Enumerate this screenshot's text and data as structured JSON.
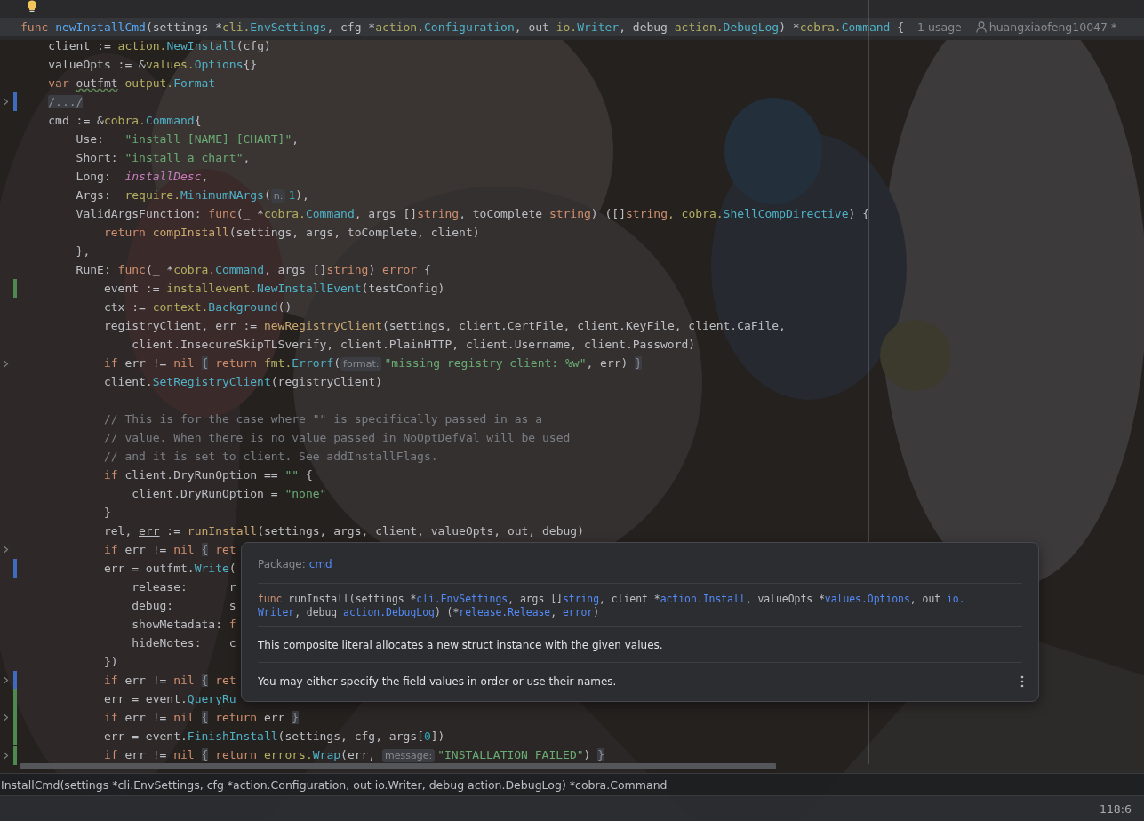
{
  "editor": {
    "signature_line": {
      "usages": "1 usage",
      "author": "huangxiaofeng10047 *",
      "tokens": [
        {
          "kind": "kw",
          "text": "func "
        },
        {
          "kind": "fn",
          "text": "newInstallCmd"
        },
        {
          "kind": "p",
          "text": "(settings *"
        },
        {
          "kind": "pkg",
          "text": "cli."
        },
        {
          "kind": "mem",
          "text": "EnvSettings"
        },
        {
          "kind": "p",
          "text": ", cfg *"
        },
        {
          "kind": "pkg",
          "text": "action."
        },
        {
          "kind": "mem",
          "text": "Configuration"
        },
        {
          "kind": "p",
          "text": ", out "
        },
        {
          "kind": "pkg",
          "text": "io."
        },
        {
          "kind": "mem",
          "text": "Writer"
        },
        {
          "kind": "p",
          "text": ", debug "
        },
        {
          "kind": "pkg",
          "text": "action."
        },
        {
          "kind": "mem",
          "text": "DebugLog"
        },
        {
          "kind": "p",
          "text": ") *"
        },
        {
          "kind": "pkg",
          "text": "cobra."
        },
        {
          "kind": "mem",
          "text": "Command"
        },
        {
          "kind": "p",
          "text": " {"
        }
      ]
    },
    "lines": [
      {
        "folded": false,
        "modified": false,
        "added": false,
        "tokens": [
          {
            "kind": "p",
            "text": "client := "
          },
          {
            "kind": "pkg",
            "text": "action."
          },
          {
            "kind": "mem",
            "text": "NewInstall"
          },
          {
            "kind": "p",
            "text": "(cfg)"
          }
        ]
      },
      {
        "folded": false,
        "modified": false,
        "added": false,
        "tokens": [
          {
            "kind": "p",
            "text": "valueOpts := &"
          },
          {
            "kind": "pkg",
            "text": "values."
          },
          {
            "kind": "mem",
            "text": "Options"
          },
          {
            "kind": "p",
            "text": "{}"
          }
        ]
      },
      {
        "folded": false,
        "modified": false,
        "added": false,
        "tokens": [
          {
            "kind": "kw",
            "text": "var "
          },
          {
            "kind": "warn",
            "text": "outfmt"
          },
          {
            "kind": "pkg",
            "text": " output."
          },
          {
            "kind": "mem",
            "text": "Format"
          }
        ]
      },
      {
        "folded": true,
        "modified": true,
        "added": false,
        "tokens": [
          {
            "kind": "fold",
            "text": "/.../"
          }
        ]
      },
      {
        "folded": false,
        "modified": false,
        "added": false,
        "tokens": [
          {
            "kind": "p",
            "text": "cmd := &"
          },
          {
            "kind": "pkg",
            "text": "cobra."
          },
          {
            "kind": "mem",
            "text": "Command"
          },
          {
            "kind": "p",
            "text": "{"
          }
        ],
        "children": [
          {
            "folded": false,
            "modified": false,
            "added": false,
            "tokens": [
              {
                "kind": "p",
                "text": "Use:   "
              },
              {
                "kind": "str",
                "text": "\"install [NAME] [CHART]\""
              },
              {
                "kind": "p",
                "text": ","
              }
            ]
          },
          {
            "folded": false,
            "modified": false,
            "added": false,
            "tokens": [
              {
                "kind": "p",
                "text": "Short: "
              },
              {
                "kind": "str",
                "text": "\"install a chart\""
              },
              {
                "kind": "p",
                "text": ","
              }
            ]
          },
          {
            "folded": false,
            "modified": false,
            "added": false,
            "tokens": [
              {
                "kind": "p",
                "text": "Long:  "
              },
              {
                "kind": "const",
                "text": "installDesc"
              },
              {
                "kind": "p",
                "text": ","
              }
            ]
          },
          {
            "folded": false,
            "modified": false,
            "added": false,
            "tokens": [
              {
                "kind": "p",
                "text": "Args:  "
              },
              {
                "kind": "pkg",
                "text": "require."
              },
              {
                "kind": "mem",
                "text": "MinimumNArgs"
              },
              {
                "kind": "p",
                "text": "("
              },
              {
                "kind": "hint",
                "text": "n:"
              },
              {
                "kind": "num",
                "text": "1"
              },
              {
                "kind": "p",
                "text": "),"
              }
            ]
          },
          {
            "folded": false,
            "modified": false,
            "added": false,
            "tokens": [
              {
                "kind": "p",
                "text": "ValidArgsFunction: "
              },
              {
                "kind": "kw",
                "text": "func"
              },
              {
                "kind": "p",
                "text": "(_ *"
              },
              {
                "kind": "pkg",
                "text": "cobra."
              },
              {
                "kind": "mem",
                "text": "Command"
              },
              {
                "kind": "p",
                "text": ", args []"
              },
              {
                "kind": "kw",
                "text": "string"
              },
              {
                "kind": "p",
                "text": ", toComplete "
              },
              {
                "kind": "kw",
                "text": "string"
              },
              {
                "kind": "p",
                "text": ") ([]"
              },
              {
                "kind": "kw",
                "text": "string"
              },
              {
                "kind": "pkg",
                "text": ", cobra."
              },
              {
                "kind": "mem",
                "text": "ShellCompDirective"
              },
              {
                "kind": "p",
                "text": ") {"
              }
            ],
            "children": [
              {
                "folded": false,
                "modified": false,
                "added": false,
                "tokens": [
                  {
                    "kind": "kw",
                    "text": "return "
                  },
                  {
                    "kind": "call",
                    "text": "compInstall"
                  },
                  {
                    "kind": "p",
                    "text": "(settings, args, toComplete, client)"
                  }
                ]
              }
            ]
          },
          {
            "folded": false,
            "modified": false,
            "added": false,
            "tokens": [
              {
                "kind": "p",
                "text": "},"
              }
            ]
          },
          {
            "folded": false,
            "modified": false,
            "added": false,
            "tokens": [
              {
                "kind": "p",
                "text": "RunE: "
              },
              {
                "kind": "kw",
                "text": "func"
              },
              {
                "kind": "p",
                "text": "(_ *"
              },
              {
                "kind": "pkg",
                "text": "cobra."
              },
              {
                "kind": "mem",
                "text": "Command"
              },
              {
                "kind": "p",
                "text": ", args []"
              },
              {
                "kind": "kw",
                "text": "string"
              },
              {
                "kind": "p",
                "text": ") "
              },
              {
                "kind": "kw",
                "text": "error"
              },
              {
                "kind": "p",
                "text": " {"
              }
            ],
            "children": [
              {
                "folded": false,
                "modified": false,
                "added": true,
                "tokens": [
                  {
                    "kind": "p",
                    "text": "event := "
                  },
                  {
                    "kind": "pkg",
                    "text": "installevent."
                  },
                  {
                    "kind": "mem",
                    "text": "NewInstallEvent"
                  },
                  {
                    "kind": "p",
                    "text": "(testConfig)"
                  }
                ]
              },
              {
                "folded": false,
                "modified": false,
                "added": false,
                "tokens": [
                  {
                    "kind": "p",
                    "text": "ctx := "
                  },
                  {
                    "kind": "pkg",
                    "text": "context."
                  },
                  {
                    "kind": "mem",
                    "text": "Background"
                  },
                  {
                    "kind": "p",
                    "text": "()"
                  }
                ]
              },
              {
                "folded": false,
                "modified": false,
                "added": false,
                "tokens": [
                  {
                    "kind": "p",
                    "text": "registryClient, err := "
                  },
                  {
                    "kind": "call",
                    "text": "newRegistryClient"
                  },
                  {
                    "kind": "p",
                    "text": "(settings, client.CertFile, client.KeyFile, client.CaFile,"
                  }
                ],
                "children": [
                  {
                    "folded": false,
                    "modified": false,
                    "added": false,
                    "tokens": [
                      {
                        "kind": "p",
                        "text": "client.InsecureSkipTLSverify, client.PlainHTTP, client.Username, client.Password)"
                      }
                    ]
                  }
                ]
              },
              {
                "folded": true,
                "modified": false,
                "added": false,
                "tokens": [
                  {
                    "kind": "kw",
                    "text": "if "
                  },
                  {
                    "kind": "p",
                    "text": "err != "
                  },
                  {
                    "kind": "kw",
                    "text": "nil "
                  },
                  {
                    "kind": "brace",
                    "text": "{"
                  },
                  {
                    "kind": "kw",
                    "text": " return "
                  },
                  {
                    "kind": "pkg",
                    "text": "fmt."
                  },
                  {
                    "kind": "mem",
                    "text": "Errorf"
                  },
                  {
                    "kind": "p",
                    "text": "("
                  },
                  {
                    "kind": "hint",
                    "text": "format:"
                  },
                  {
                    "kind": "str",
                    "text": "\"missing registry client: %w\""
                  },
                  {
                    "kind": "p",
                    "text": ", err) "
                  },
                  {
                    "kind": "brace",
                    "text": "}"
                  }
                ]
              },
              {
                "folded": false,
                "modified": false,
                "added": false,
                "tokens": [
                  {
                    "kind": "p",
                    "text": "client."
                  },
                  {
                    "kind": "mem",
                    "text": "SetRegistryClient"
                  },
                  {
                    "kind": "p",
                    "text": "(registryClient)"
                  }
                ]
              },
              {
                "folded": false,
                "modified": false,
                "added": false
              },
              {
                "folded": false,
                "modified": false,
                "added": false,
                "tokens": [
                  {
                    "kind": "cmt",
                    "text": "// This is for the case where \"\" is specifically passed in as a"
                  }
                ]
              },
              {
                "folded": false,
                "modified": false,
                "added": false,
                "tokens": [
                  {
                    "kind": "cmt",
                    "text": "// value. When there is no value passed in NoOptDefVal will be used"
                  }
                ]
              },
              {
                "folded": false,
                "modified": false,
                "added": false,
                "tokens": [
                  {
                    "kind": "cmt",
                    "text": "// and it is set to client. See addInstallFlags."
                  }
                ]
              },
              {
                "folded": false,
                "modified": false,
                "added": false,
                "tokens": [
                  {
                    "kind": "kw",
                    "text": "if "
                  },
                  {
                    "kind": "p",
                    "text": "client.DryRunOption == "
                  },
                  {
                    "kind": "str",
                    "text": "\"\""
                  },
                  {
                    "kind": "p",
                    "text": " {"
                  }
                ],
                "children": [
                  {
                    "folded": false,
                    "modified": false,
                    "added": false,
                    "tokens": [
                      {
                        "kind": "p",
                        "text": "client.DryRunOption = "
                      },
                      {
                        "kind": "str",
                        "text": "\"none\""
                      }
                    ]
                  }
                ]
              },
              {
                "folded": false,
                "modified": false,
                "added": false,
                "tokens": [
                  {
                    "kind": "p",
                    "text": "}"
                  }
                ]
              },
              {
                "folded": false,
                "modified": false,
                "added": false,
                "tokens": [
                  {
                    "kind": "p",
                    "text": "rel, "
                  },
                  {
                    "kind": "ref",
                    "text": "err"
                  },
                  {
                    "kind": "p",
                    "text": " := "
                  },
                  {
                    "kind": "call",
                    "text": "runInstall"
                  },
                  {
                    "kind": "p",
                    "text": "(settings, args, client, valueOpts, out, debug)"
                  }
                ]
              },
              {
                "folded": true,
                "modified": false,
                "added": false,
                "tokens": [
                  {
                    "kind": "kw",
                    "text": "if "
                  },
                  {
                    "kind": "p",
                    "text": "err != "
                  },
                  {
                    "kind": "kw",
                    "text": "nil "
                  },
                  {
                    "kind": "brace",
                    "text": "{"
                  },
                  {
                    "kind": "kw",
                    "text": " ret"
                  }
                ]
              },
              {
                "folded": false,
                "modified": true,
                "added": false,
                "tokens": [
                  {
                    "kind": "p",
                    "text": "err = outfmt."
                  },
                  {
                    "kind": "mem",
                    "text": "Write"
                  },
                  {
                    "kind": "p",
                    "text": "("
                  }
                ],
                "children": [
                  {
                    "folded": false,
                    "modified": false,
                    "added": false,
                    "tokens": [
                      {
                        "kind": "p",
                        "text": "release:      r"
                      }
                    ]
                  },
                  {
                    "folded": false,
                    "modified": false,
                    "added": false,
                    "tokens": [
                      {
                        "kind": "p",
                        "text": "debug:        s"
                      }
                    ]
                  },
                  {
                    "folded": false,
                    "modified": false,
                    "added": false,
                    "tokens": [
                      {
                        "kind": "p",
                        "text": "showMetadata: "
                      },
                      {
                        "kind": "kw",
                        "text": "f"
                      }
                    ]
                  },
                  {
                    "folded": false,
                    "modified": false,
                    "added": false,
                    "tokens": [
                      {
                        "kind": "p",
                        "text": "hideNotes:    c"
                      }
                    ]
                  }
                ]
              },
              {
                "folded": false,
                "modified": false,
                "added": false,
                "tokens": [
                  {
                    "kind": "p",
                    "text": "})"
                  }
                ]
              },
              {
                "folded": true,
                "modified": true,
                "added": false,
                "tokens": [
                  {
                    "kind": "kw",
                    "text": "if "
                  },
                  {
                    "kind": "p",
                    "text": "err != "
                  },
                  {
                    "kind": "kw",
                    "text": "nil "
                  },
                  {
                    "kind": "brace",
                    "text": "{"
                  },
                  {
                    "kind": "kw",
                    "text": " ret"
                  }
                ]
              },
              {
                "folded": false,
                "modified": false,
                "added": true,
                "tokens": [
                  {
                    "kind": "p",
                    "text": "err = event."
                  },
                  {
                    "kind": "mem",
                    "text": "QueryRu"
                  }
                ]
              },
              {
                "folded": true,
                "modified": false,
                "added": true,
                "tokens": [
                  {
                    "kind": "kw",
                    "text": "if "
                  },
                  {
                    "kind": "p",
                    "text": "err != "
                  },
                  {
                    "kind": "kw",
                    "text": "nil "
                  },
                  {
                    "kind": "brace",
                    "text": "{"
                  },
                  {
                    "kind": "kw",
                    "text": " return "
                  },
                  {
                    "kind": "p",
                    "text": "err "
                  },
                  {
                    "kind": "brace",
                    "text": "}"
                  }
                ]
              },
              {
                "folded": false,
                "modified": false,
                "added": true,
                "tokens": [
                  {
                    "kind": "p",
                    "text": "err = event."
                  },
                  {
                    "kind": "mem",
                    "text": "FinishInstall"
                  },
                  {
                    "kind": "p",
                    "text": "(settings, cfg, args["
                  },
                  {
                    "kind": "num",
                    "text": "0"
                  },
                  {
                    "kind": "p",
                    "text": "])"
                  }
                ]
              },
              {
                "folded": true,
                "modified": false,
                "added": true,
                "tokens": [
                  {
                    "kind": "kw",
                    "text": "if "
                  },
                  {
                    "kind": "p",
                    "text": "err != "
                  },
                  {
                    "kind": "kw",
                    "text": "nil "
                  },
                  {
                    "kind": "brace",
                    "text": "{"
                  },
                  {
                    "kind": "kw",
                    "text": " return "
                  },
                  {
                    "kind": "pkg",
                    "text": "errors."
                  },
                  {
                    "kind": "mem",
                    "text": "Wrap"
                  },
                  {
                    "kind": "p",
                    "text": "(err, "
                  },
                  {
                    "kind": "hint",
                    "text": "message:"
                  },
                  {
                    "kind": "str",
                    "text": "\"INSTALLATION FAILED\""
                  },
                  {
                    "kind": "p",
                    "text": ") "
                  },
                  {
                    "kind": "brace",
                    "text": "}"
                  }
                ]
              }
            ]
          }
        ]
      }
    ]
  },
  "popup": {
    "package_label": "Package:",
    "package": "cmd",
    "signature": [
      [
        {
          "kind": "kw",
          "text": "func "
        },
        {
          "kind": "p",
          "text": "runInstall(settings *"
        },
        {
          "kind": "type",
          "text": "cli.EnvSettings"
        },
        {
          "kind": "p",
          "text": ", args []"
        },
        {
          "kind": "type",
          "text": "string"
        },
        {
          "kind": "p",
          "text": ", client *"
        },
        {
          "kind": "type",
          "text": "action.Install"
        },
        {
          "kind": "p",
          "text": ", valueOpts *"
        },
        {
          "kind": "type",
          "text": "values.Options"
        },
        {
          "kind": "p",
          "text": ", out "
        },
        {
          "kind": "type",
          "text": "io."
        }
      ],
      [
        {
          "kind": "type",
          "text": "Writer"
        },
        {
          "kind": "p",
          "text": ", debug "
        },
        {
          "kind": "type",
          "text": "action.DebugLog"
        },
        {
          "kind": "p",
          "text": ") (*"
        },
        {
          "kind": "type",
          "text": "release.Release"
        },
        {
          "kind": "p",
          "text": ", "
        },
        {
          "kind": "type",
          "text": "error"
        },
        {
          "kind": "p",
          "text": ")"
        }
      ]
    ],
    "descriptions": [
      "This composite literal allocates a new struct instance with the given values.",
      "You may either specify the field values in order or use their names."
    ]
  },
  "breadcrumb": "InstallCmd(settings *cli.EnvSettings, cfg *action.Configuration, out io.Writer, debug action.DebugLog) *cobra.Command",
  "status_bar": {
    "caret_position": "118:6"
  }
}
